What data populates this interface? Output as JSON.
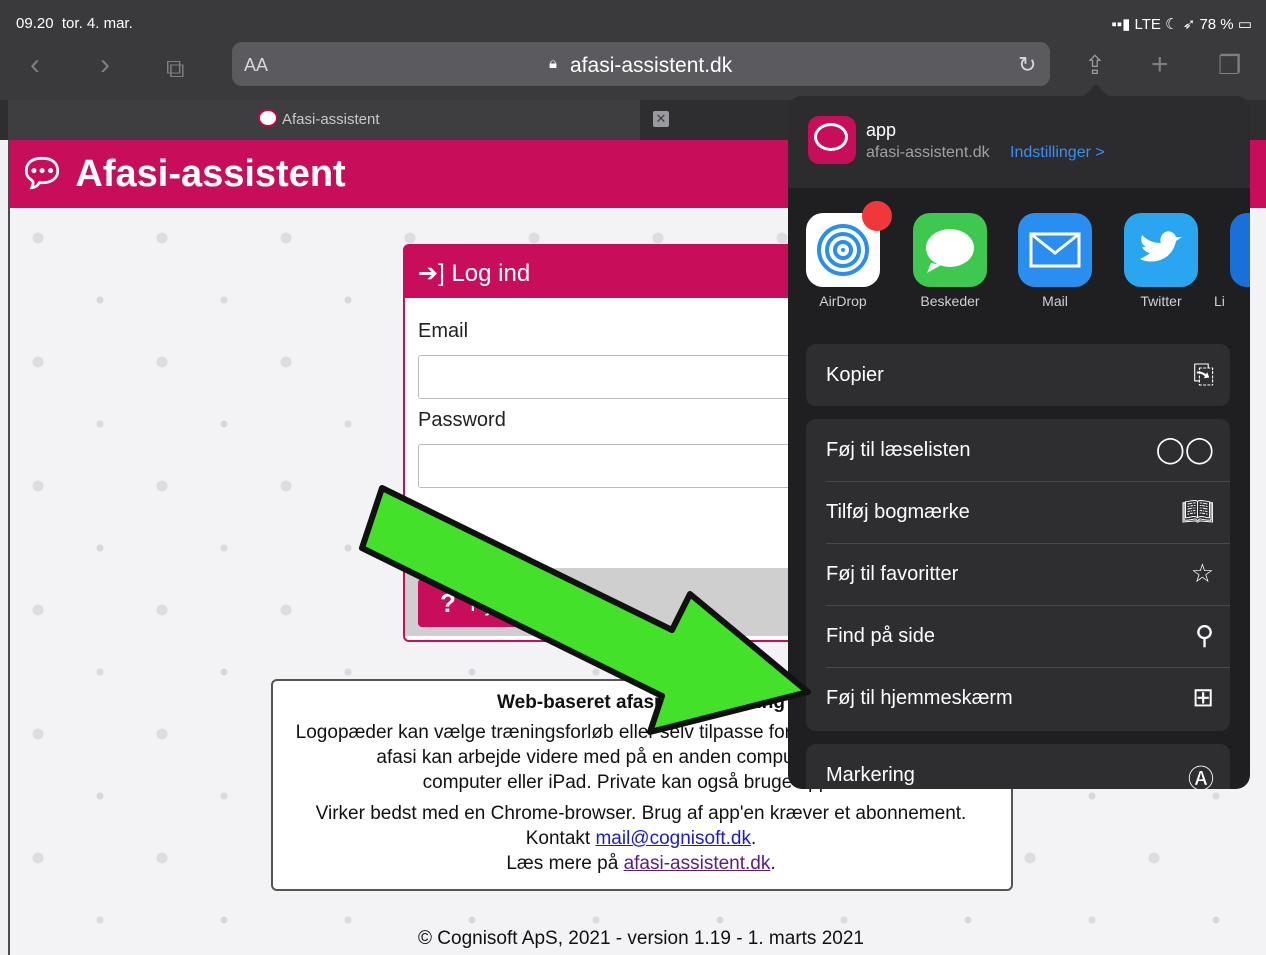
{
  "status": {
    "time": "09.20",
    "date": "tor. 4. mar.",
    "network": "LTE",
    "battery": "78 %"
  },
  "browser": {
    "aa_label": "AA",
    "url": "afasi-assistent.dk",
    "tab_title": "Afasi-assistent"
  },
  "site": {
    "logo": "Afasi-assistent",
    "login": {
      "title": "Log ind",
      "email_label": "Email",
      "password_label": "Password",
      "help_label": "Hjælp"
    },
    "info": {
      "title": "Web-baseret afasi-undervisning",
      "line1": "Logopæder kan vælge træningsforløb eller selv tilpasse forløb, som personer med",
      "line2": "afasi kan arbejde videre med på en anden computer eller iPad.",
      "line3": "computer eller iPad. Private kan også bruge app'en.",
      "line4": "Virker bedst med en Chrome-browser. Brug af app'en kræver et abonnement.",
      "contact_prefix": "Kontakt ",
      "contact_link": "mail@cognisoft.dk",
      "contact_suffix": ".",
      "more_prefix": "Læs mere på ",
      "more_link": "afasi-assistent.dk",
      "more_suffix": "."
    },
    "footer": "© Cognisoft ApS, 2021 - version 1.19 - 1. marts 2021"
  },
  "share": {
    "app_name": "app",
    "app_url": "afasi-assistent.dk",
    "settings_label": "Indstillinger >",
    "apps": [
      {
        "label": "AirDrop",
        "icon": "airdrop-icon"
      },
      {
        "label": "Beskeder",
        "icon": "messages-icon"
      },
      {
        "label": "Mail",
        "icon": "mail-icon"
      },
      {
        "label": "Twitter",
        "icon": "twitter-icon"
      },
      {
        "label": "Li",
        "icon": "linkedin-icon"
      }
    ],
    "actions": [
      {
        "label": "Kopier",
        "icon": "copy-icon"
      },
      {
        "label": "Føj til læselisten",
        "icon": "glasses-icon"
      },
      {
        "label": "Tilføj bogmærke",
        "icon": "book-icon"
      },
      {
        "label": "Føj til favoritter",
        "icon": "star-icon"
      },
      {
        "label": "Find på side",
        "icon": "search-icon"
      },
      {
        "label": "Føj til hjemmeskærm",
        "icon": "add-square-icon"
      },
      {
        "label": "Markering",
        "icon": "markup-icon"
      }
    ]
  },
  "colors": {
    "brand": "#c80d5a",
    "arrow": "#44e12a",
    "sheet": "#1f1f21"
  }
}
